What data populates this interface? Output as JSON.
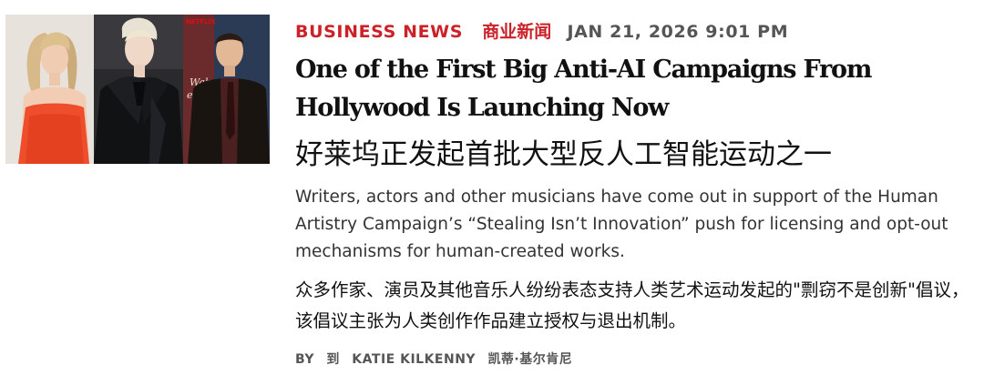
{
  "article": {
    "category": "BUSINESS NEWS",
    "category_zh": "商业新闻",
    "date": "JAN 21, 2026 9:01 PM",
    "title": "One of the First Big Anti-AI Campaigns From Hollywood Is Launching Now",
    "title_zh": "好莱坞正发起首批大型反人工智能运动之一",
    "dek": "Writers, actors and other musicians have come out in support of the Human Artistry Campaign’s “Stealing Isn’t Innovation” push for licensing and opt-out mechanisms for human-created works.",
    "dek_zh": "众多作家、演员及其他音乐人纷纷表态支持人类艺术运动发起的\"剽窃不是创新\"倡议，该倡议主张为人类创作作品建立授权与退出机制。",
    "byline_prefix": "BY",
    "byline_prefix_zh": "到",
    "author": "KATIE KILKENNY",
    "author_zh": "凯蒂·基尔肯尼"
  },
  "image": {
    "backdrop_text_left": "NETFLIX",
    "backdrop_text_right": "Wake",
    "backdrop_text_right_2": "ead M"
  },
  "colors": {
    "accent": "#cc2129",
    "meta_gray": "#555555",
    "text": "#111111"
  }
}
